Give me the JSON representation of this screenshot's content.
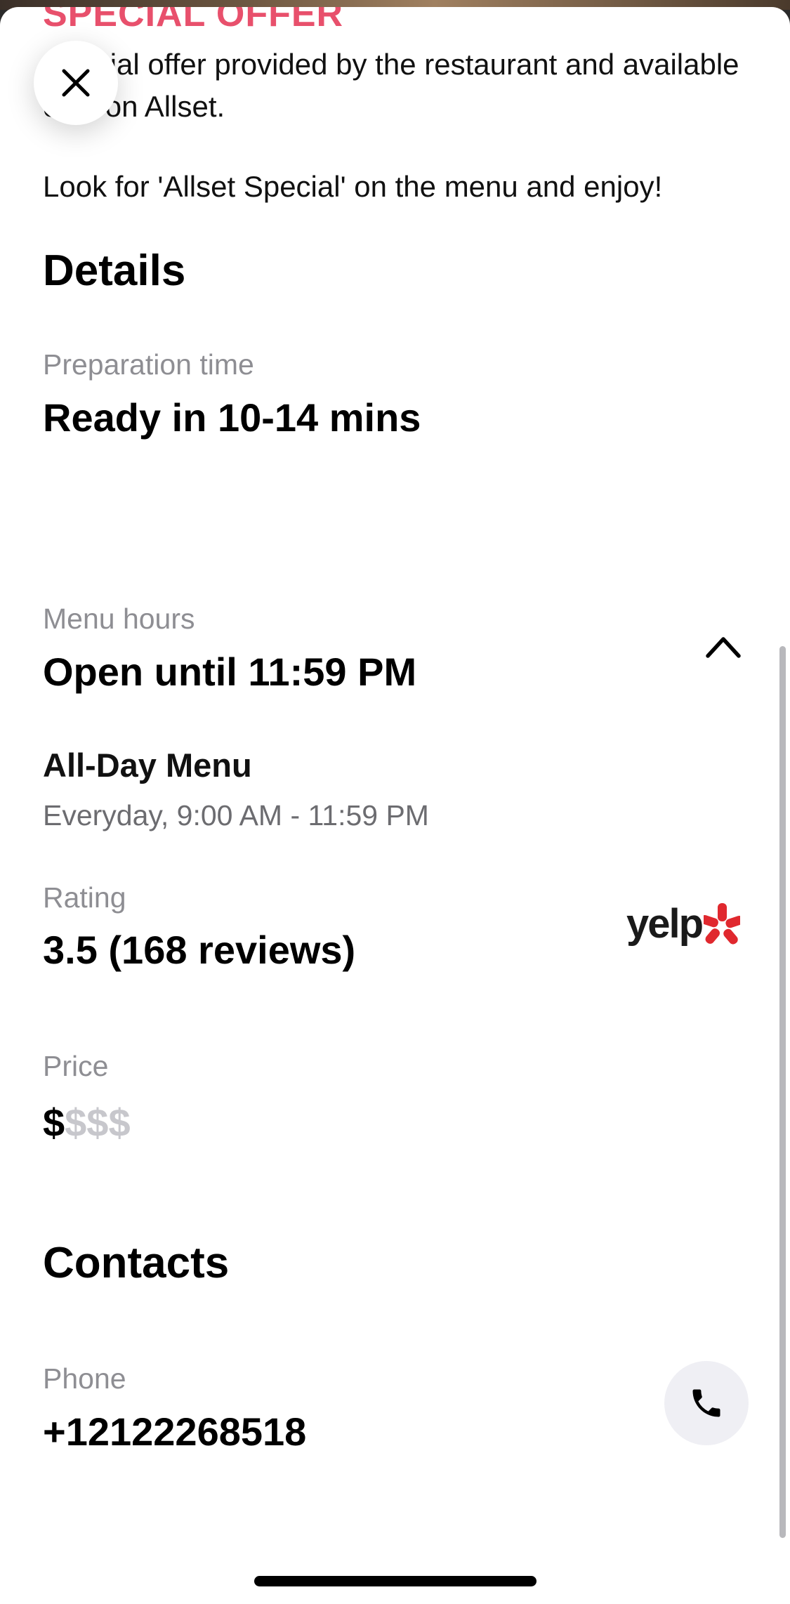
{
  "offer": {
    "title": "SPECIAL OFFER",
    "description": "Special offer provided by the restaurant and available only on Allset.",
    "hint": "Look for 'Allset Special' on the menu and enjoy!"
  },
  "details": {
    "title": "Details",
    "prep_label": "Preparation time",
    "prep_value": "Ready in 10-14 mins",
    "hours_label": "Menu hours",
    "hours_value": "Open until 11:59 PM",
    "menu_name": "All-Day Menu",
    "menu_schedule": "Everyday, 9:00 AM - 11:59 PM",
    "rating_label": "Rating",
    "rating_value": "3.5 (168 reviews)",
    "rating_source": "yelp",
    "price_label": "Price",
    "price_active": "$",
    "price_inactive": "$$$",
    "price_level": 1,
    "price_max": 4
  },
  "contacts": {
    "title": "Contacts",
    "phone_label": "Phone",
    "phone_value": "+12122268518"
  },
  "icons": {
    "close": "close-icon",
    "collapse": "chevron-up-icon",
    "call": "phone-icon",
    "rating_brand": "yelp-logo"
  },
  "colors": {
    "accent": "#e8506c",
    "yelp_red": "#e0282e",
    "label_gray": "#8e8e93",
    "inactive_price": "#c7c7cc",
    "button_bg": "#efeff4"
  }
}
